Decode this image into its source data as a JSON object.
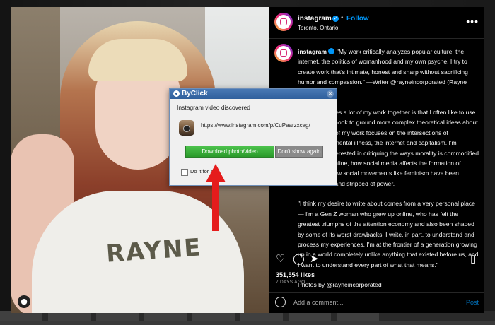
{
  "post": {
    "account": {
      "username": "instagram",
      "follow_label": "Follow",
      "location": "Toronto, Ontario",
      "verified_mark": "✓"
    },
    "more_label": "•••",
    "shirt_print": "RAYNE",
    "caption": {
      "username": "instagram",
      "p1": "\"My work critically analyzes popular culture, the internet, the politics of womanhood and my own psyche. I try to create work that's intimate, honest and sharp without sacrificing humor and compassion.\" —Writer @rayneincorporated (Rayne Fisher-Quann)",
      "p2": "\"I think what ties a lot of my work together is that I often like to use a pop culture hook to ground more complex theoretical ideas about morality. A lot of my work focuses on the intersections of womanhood, mental illness, the internet and capitalism. I'm particularly interested in critiquing the ways morality is commodified and warped online, how social media affects the formation of identity and how social movements like feminism have been aestheticized and stripped of power.",
      "p3": "\"I think my desire to write about comes from a very personal place — I'm a Gen Z woman who grew up online, who has felt the greatest triumphs of the attention economy and also been shaped by some of its worst drawbacks. I write, in part, to understand and process my experiences. I'm at the frontier of a generation growing up in a world completely unlike anything that existed before us, and I want to understand every part of what that means.\"",
      "p4": "Photos by @rayneincorporated"
    },
    "likes": "351,554 likes",
    "posted_ago": "7 DAYS AGO",
    "comment_placeholder": "Add a comment...",
    "post_label": "Post"
  },
  "dialog": {
    "title": "ByClick",
    "close_label": "×",
    "discovered_text": "Instagram video discovered",
    "url": "https://www.instagram.com/p/CuPaarzxcag/",
    "download_label": "Download photo/video",
    "dont_show_label": "Don't show again",
    "checkbox_label": "Do it for all"
  },
  "colors": {
    "instagram_blue": "#0095f6",
    "download_green": "#2b9a2b",
    "arrow_red": "#e51c1c",
    "dialog_title_blue": "#2f5f9c"
  }
}
